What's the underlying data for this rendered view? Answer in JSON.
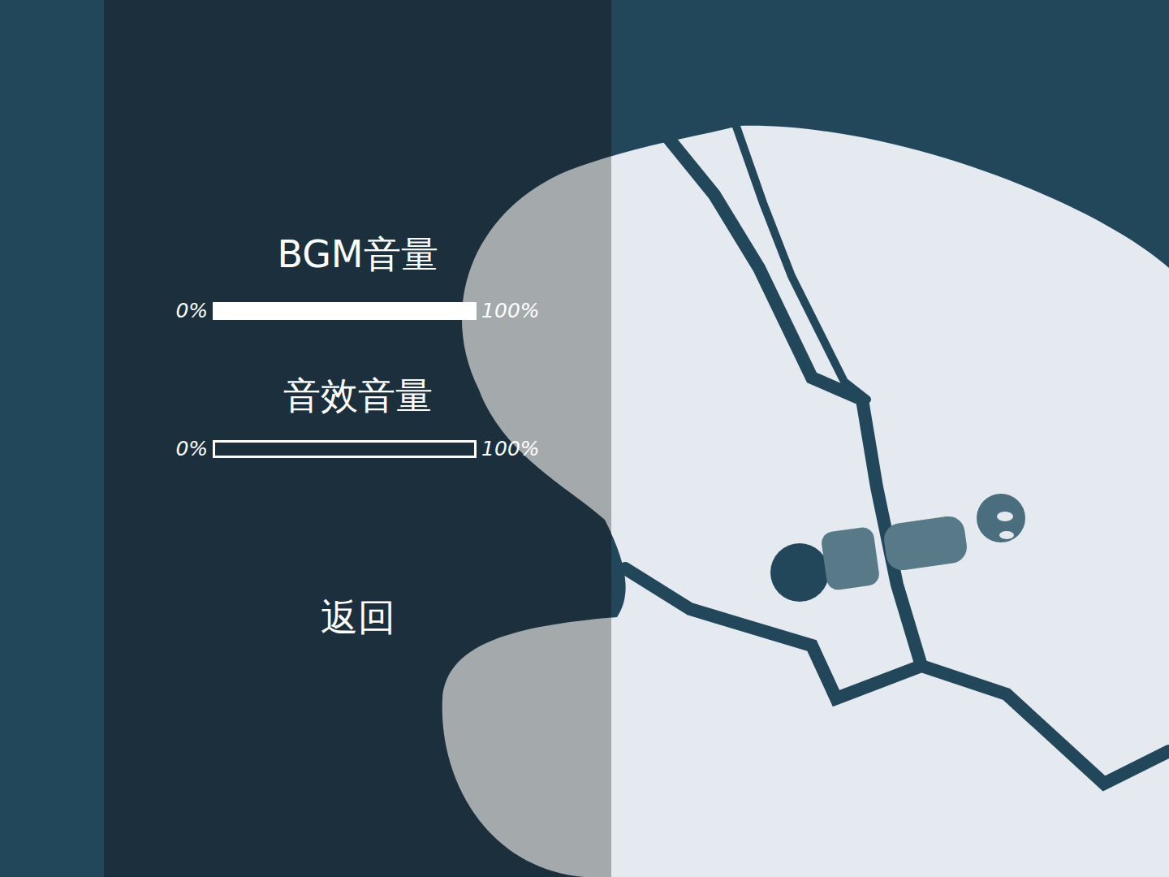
{
  "settings": {
    "sliders": [
      {
        "label": "BGM音量",
        "min_label": "0%",
        "max_label": "100%",
        "level": 1
      },
      {
        "label": "音效音量",
        "min_label": "0%",
        "max_label": "100%",
        "level": 0
      }
    ]
  },
  "buttons": [
    "返回"
  ]
}
